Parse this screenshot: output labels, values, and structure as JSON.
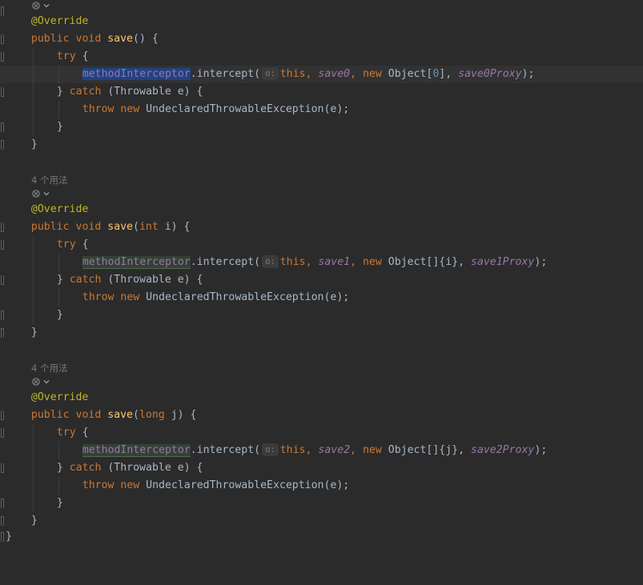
{
  "editor": {
    "theme_colors": {
      "background": "#2b2b2b",
      "keyword": "#cc7832",
      "annotation": "#bbb529",
      "method": "#ffc66d",
      "field": "#9876aa",
      "text": "#a9b7c6",
      "number": "#6897bb"
    },
    "usages_label_2": "4 个用法",
    "usages_label_3": "4 个用法",
    "methods": [
      {
        "annotation": "@Override",
        "kw_public": "public",
        "kw_void": "void",
        "name": "save",
        "params_open": "(",
        "param_type": "",
        "param_name": "",
        "params_close": ") {",
        "kw_try": "try",
        "try_brace": " {",
        "interceptor": "methodInterceptor",
        "intercept_call": ".intercept(",
        "hint": "o:",
        "kw_this": "this",
        "comma1": ", ",
        "method_field": "save0",
        "comma2": ", ",
        "kw_new": "new",
        "object_expr_a": " Object[",
        "object_num": "0",
        "object_expr_b": "], ",
        "proxy_field": "save0Proxy",
        "call_end": ");",
        "catch_open": "} ",
        "kw_catch": "catch",
        "catch_params": " (Throwable e) {",
        "kw_throw": "throw",
        "throw_new": "new",
        "throw_expr": " UndeclaredThrowableException(e);",
        "inner_close": "}",
        "outer_close": "}"
      },
      {
        "annotation": "@Override",
        "kw_public": "public",
        "kw_void": "void",
        "name": "save",
        "params_open": "(",
        "param_type": "int",
        "param_name": " i",
        "params_close": ") {",
        "kw_try": "try",
        "try_brace": " {",
        "interceptor": "methodInterceptor",
        "intercept_call": ".intercept(",
        "hint": "o:",
        "kw_this": "this",
        "comma1": ", ",
        "method_field": "save1",
        "comma2": ", ",
        "kw_new": "new",
        "object_expr_a": " Object[]{i}, ",
        "object_num": "",
        "object_expr_b": "",
        "proxy_field": "save1Proxy",
        "call_end": ");",
        "catch_open": "} ",
        "kw_catch": "catch",
        "catch_params": " (Throwable e) {",
        "kw_throw": "throw",
        "throw_new": "new",
        "throw_expr": " UndeclaredThrowableException(e);",
        "inner_close": "}",
        "outer_close": "}"
      },
      {
        "annotation": "@Override",
        "kw_public": "public",
        "kw_void": "void",
        "name": "save",
        "params_open": "(",
        "param_type": "long",
        "param_name": " j",
        "params_close": ") {",
        "kw_try": "try",
        "try_brace": " {",
        "interceptor": "methodInterceptor",
        "intercept_call": ".intercept(",
        "hint": "o:",
        "kw_this": "this",
        "comma1": ", ",
        "method_field": "save2",
        "comma2": ", ",
        "kw_new": "new",
        "object_expr_a": " Object[]{j}, ",
        "object_num": "",
        "object_expr_b": "",
        "proxy_field": "save2Proxy",
        "call_end": ");",
        "catch_open": "} ",
        "kw_catch": "catch",
        "catch_params": " (Throwable e) {",
        "kw_throw": "throw",
        "throw_new": "new",
        "throw_expr": " UndeclaredThrowableException(e);",
        "inner_close": "}",
        "outer_close": "}"
      }
    ],
    "class_close": "}",
    "icons": {
      "implement": "implement-method-icon",
      "dropdown": "chevron-down-icon"
    }
  }
}
